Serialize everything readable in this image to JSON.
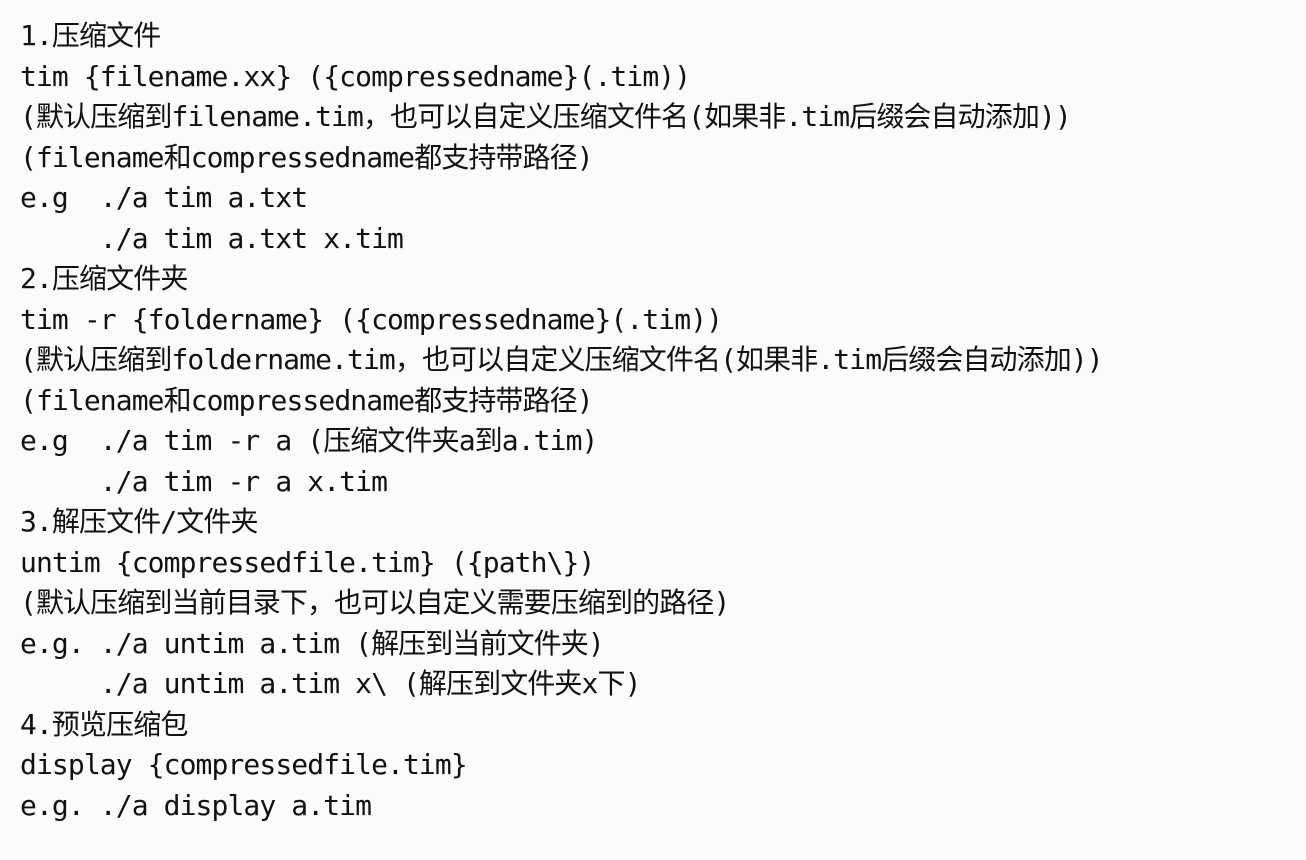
{
  "lines": [
    "1.压缩文件",
    "tim {filename.xx} ({compressedname}(.tim))",
    "(默认压缩到filename.tim，也可以自定义压缩文件名(如果非.tim后缀会自动添加))",
    "(filename和compressedname都支持带路径)",
    "e.g  ./a tim a.txt",
    "     ./a tim a.txt x.tim",
    "2.压缩文件夹",
    "tim -r {foldername} ({compressedname}(.tim))",
    "(默认压缩到foldername.tim，也可以自定义压缩文件名(如果非.tim后缀会自动添加))",
    "(filename和compressedname都支持带路径)",
    "e.g  ./a tim -r a (压缩文件夹a到a.tim)",
    "     ./a tim -r a x.tim",
    "3.解压文件/文件夹",
    "untim {compressedfile.tim} ({path\\})",
    "(默认压缩到当前目录下，也可以自定义需要压缩到的路径)",
    "e.g. ./a untim a.tim (解压到当前文件夹)",
    "     ./a untim a.tim x\\ (解压到文件夹x下)",
    "4.预览压缩包",
    "display {compressedfile.tim}",
    "e.g. ./a display a.tim"
  ]
}
